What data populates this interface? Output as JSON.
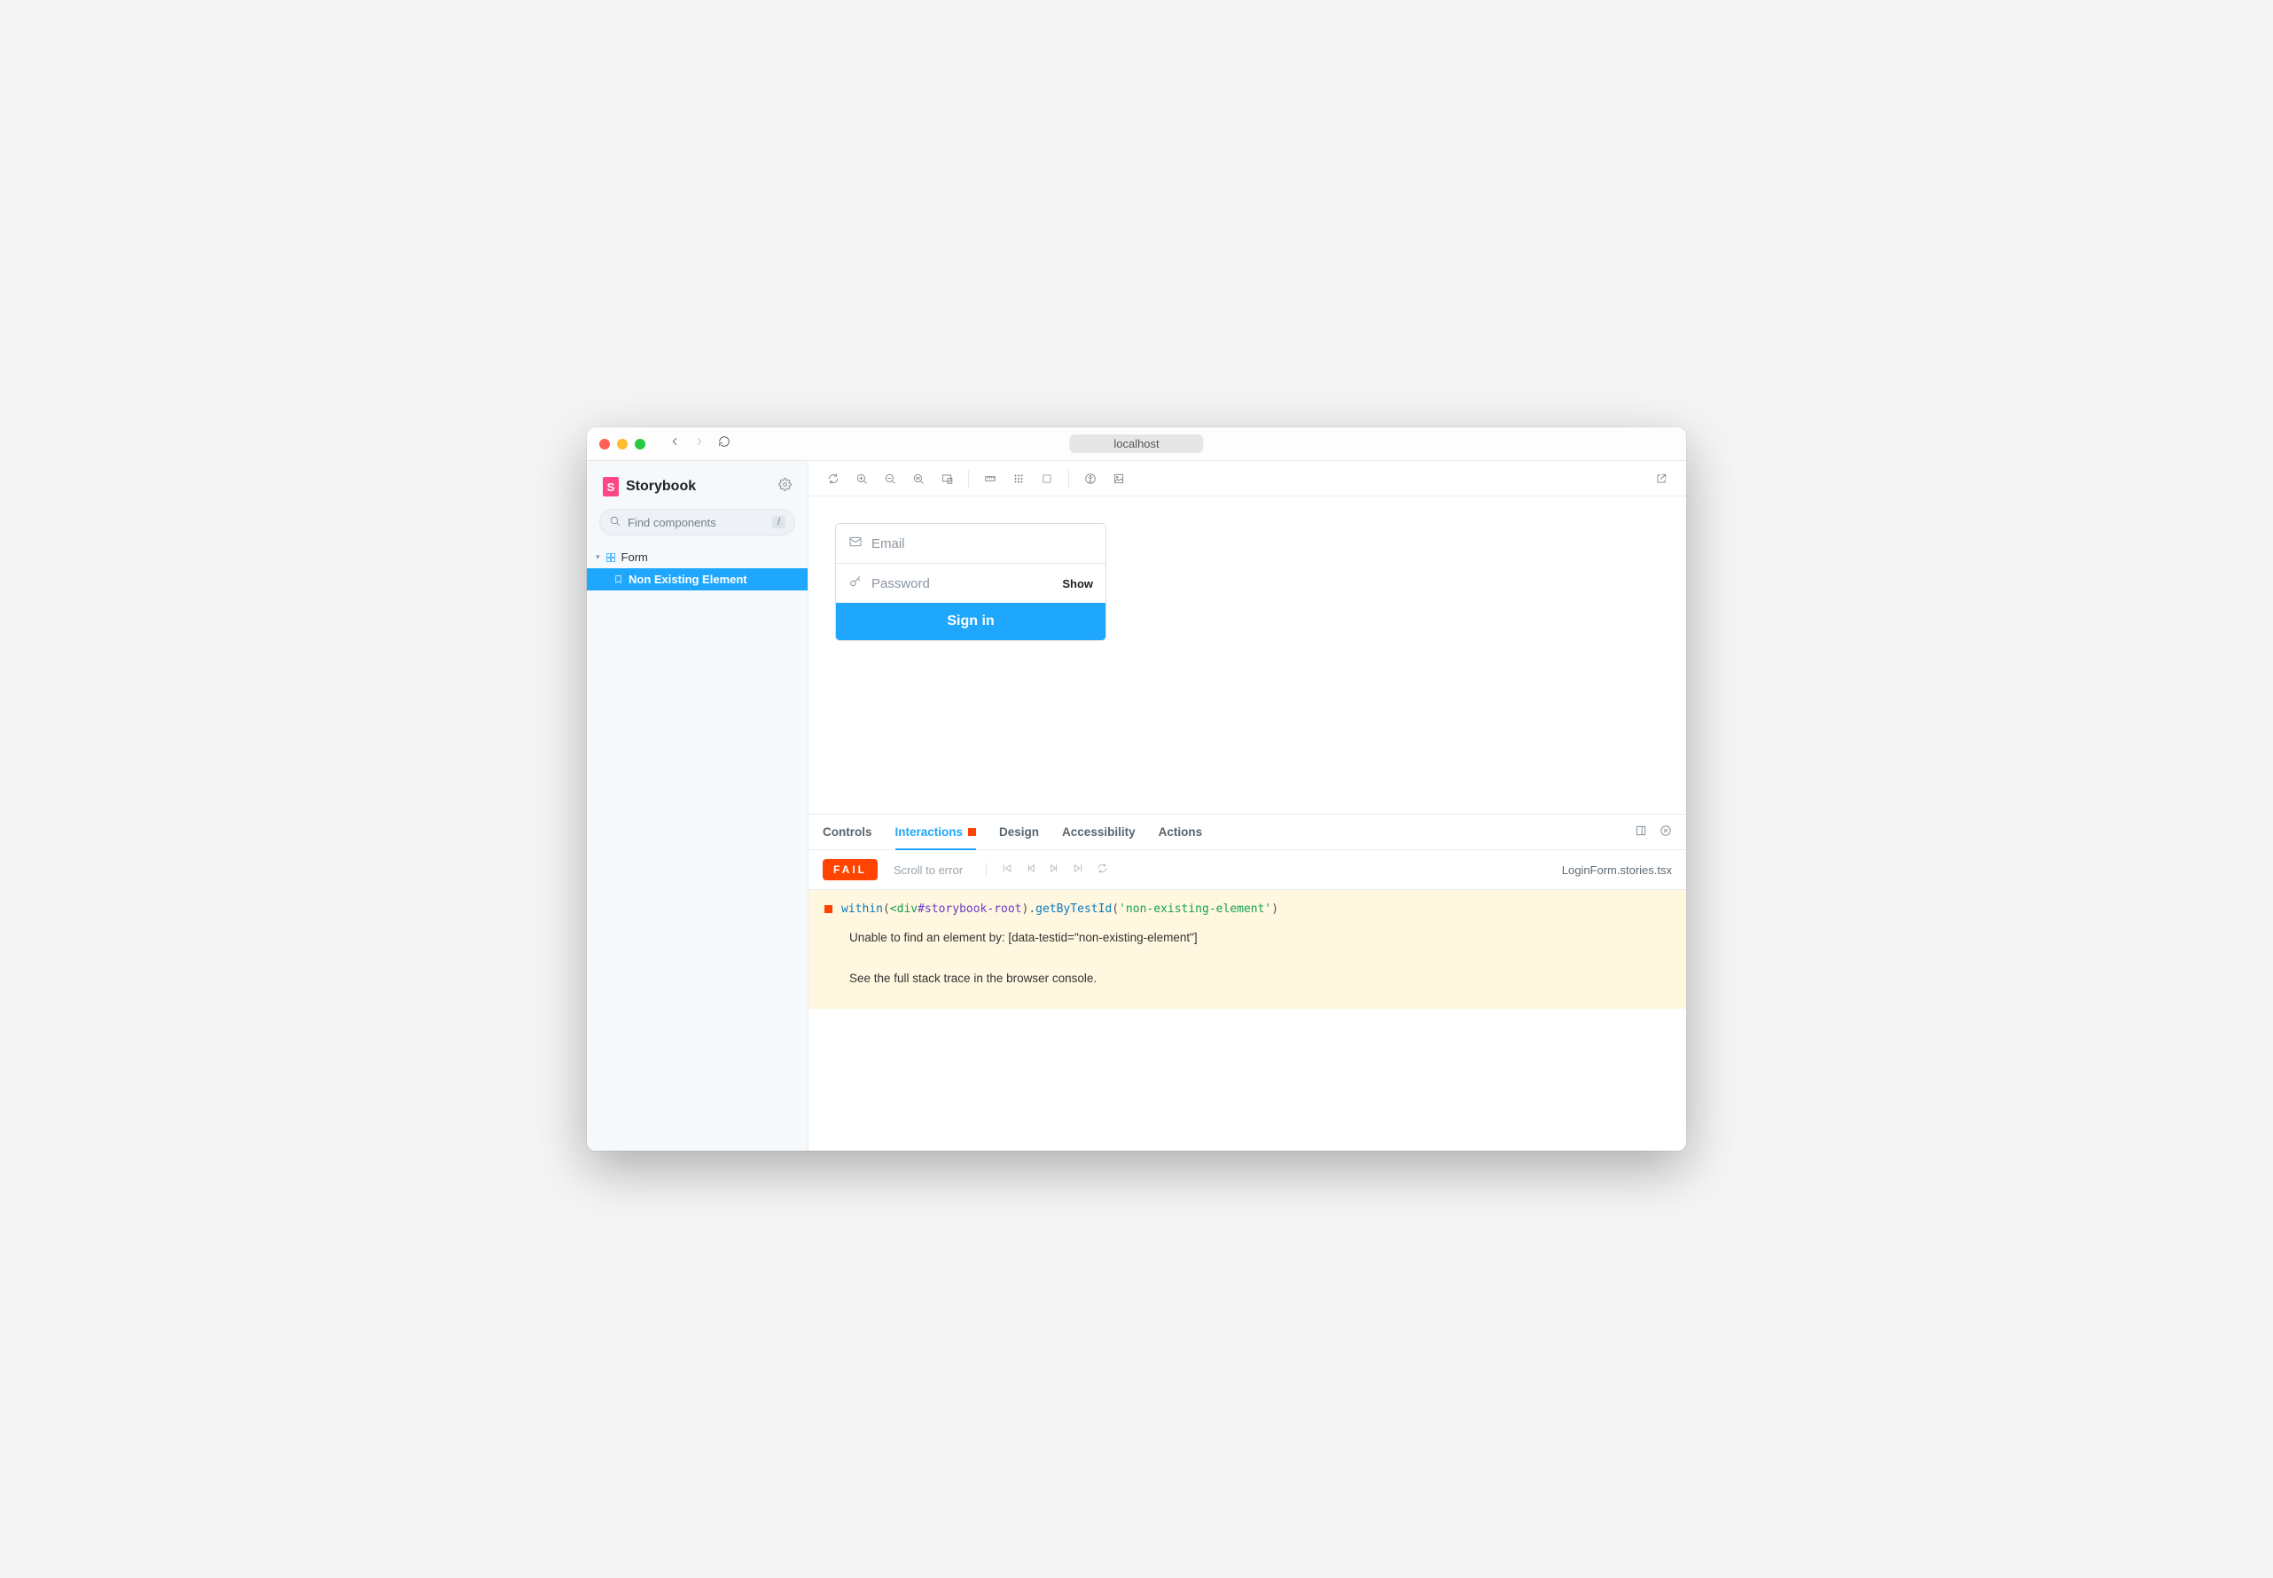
{
  "browser": {
    "url": "localhost"
  },
  "sidebar": {
    "brand": "Storybook",
    "search_placeholder": "Find components",
    "search_key": "/",
    "tree": {
      "parent": "Form",
      "child": "Non Existing Element"
    }
  },
  "preview": {
    "email_placeholder": "Email",
    "password_placeholder": "Password",
    "show_label": "Show",
    "signin_label": "Sign in"
  },
  "addons": {
    "tabs": {
      "controls": "Controls",
      "interactions": "Interactions",
      "design": "Design",
      "accessibility": "Accessibility",
      "actions": "Actions"
    },
    "subbar": {
      "status": "FAIL",
      "scroll": "Scroll to error",
      "file": "LoginForm.stories.tsx"
    },
    "error": {
      "code": {
        "fn1": "within",
        "p1": "(",
        "tag_open": "<div",
        "sel": "#storybook-root",
        "p2": ").",
        "fn2": "getByTestId",
        "p3": "(",
        "str": "'non-existing-element'",
        "p4": ")"
      },
      "line1": "Unable to find an element by: [data-testid=\"non-existing-element\"]",
      "line2": "See the full stack trace in the browser console."
    }
  }
}
